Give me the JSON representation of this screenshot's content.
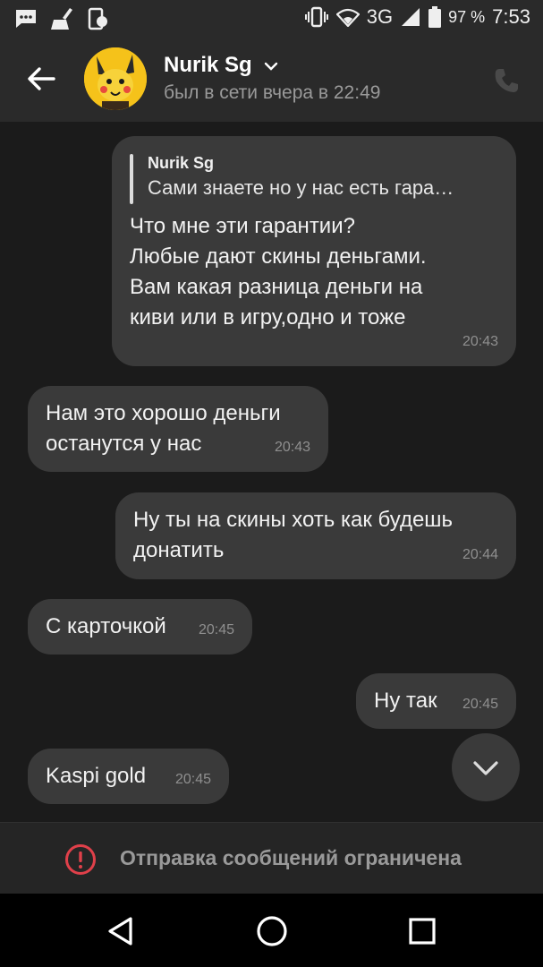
{
  "status_bar": {
    "network": "3G",
    "battery": "97 %",
    "time": "7:53",
    "icons": [
      "message-icon",
      "cleaner-icon",
      "device-manager-icon",
      "vibrate-icon",
      "wifi-icon",
      "signal-icon",
      "battery-icon"
    ]
  },
  "header": {
    "contact_name": "Nurik Sg",
    "last_seen": "был в сети вчера в 22:49"
  },
  "messages": [
    {
      "direction": "outgoing",
      "quote": {
        "author": "Nurik Sg",
        "text": "Сами знаете но у нас есть гара…"
      },
      "text": "Что мне эти гарантии?\nЛюбые дают скины деньгами.\nВам какая разница деньги на\nкиви или в игру,одно и тоже",
      "time": "20:43"
    },
    {
      "direction": "incoming",
      "text": "Нам это хорошо деньги\nостанутся у нас",
      "time": "20:43"
    },
    {
      "direction": "outgoing",
      "text": "Ну ты на скины хоть как будешь\nдонатить",
      "time": "20:44"
    },
    {
      "direction": "incoming",
      "text": "С карточкой",
      "time": "20:45"
    },
    {
      "direction": "outgoing",
      "text": "Ну так",
      "time": "20:45"
    },
    {
      "direction": "incoming",
      "text": "Kaspi gold",
      "time": "20:45"
    }
  ],
  "footer": {
    "restricted_text": "Отправка сообщений ограничена"
  },
  "colors": {
    "background": "#1b1b1b",
    "bubble": "#3a3a3a",
    "header": "#2a2a2a",
    "warning": "#e0404a"
  }
}
